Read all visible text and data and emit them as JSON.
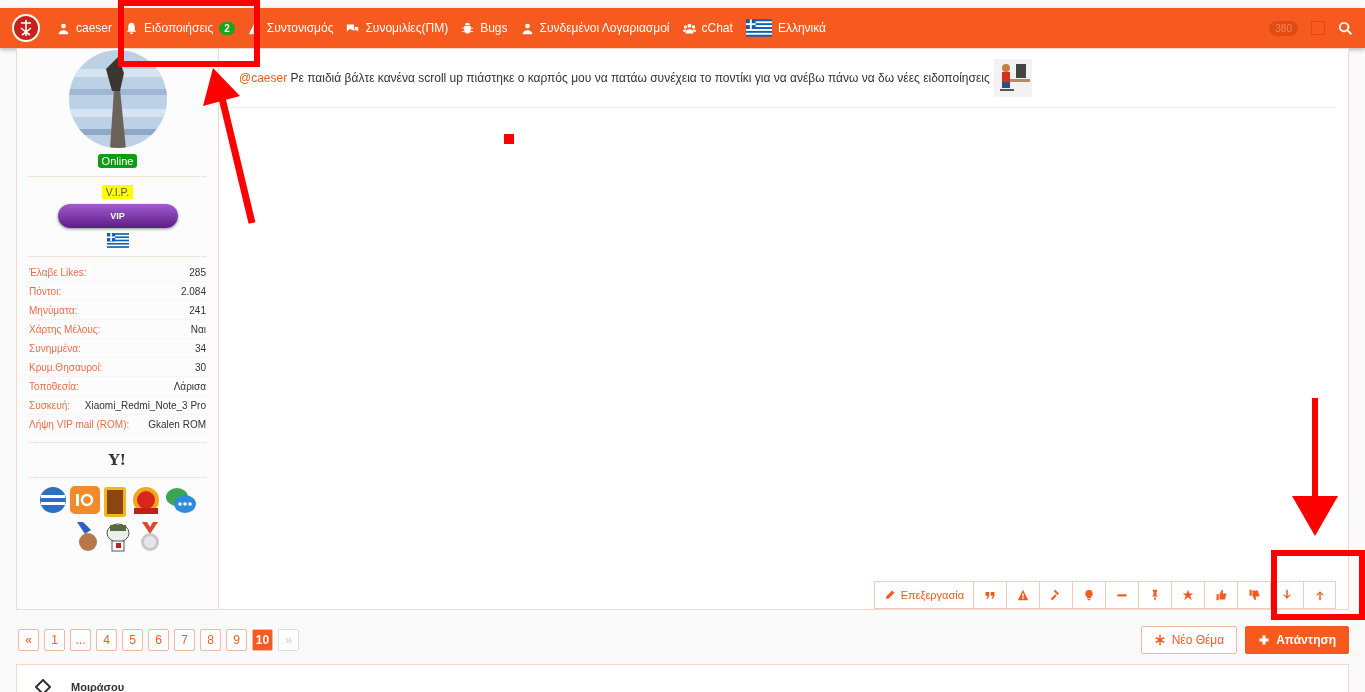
{
  "nav": {
    "items": [
      {
        "kind": "user",
        "label": "caeser"
      },
      {
        "kind": "bell",
        "label": "Ειδοποιήσεις",
        "badge": "2"
      },
      {
        "kind": "warning",
        "label": "Συντονισμός"
      },
      {
        "kind": "chat",
        "label": "Συνομιλίες(ΠΜ)"
      },
      {
        "kind": "bug",
        "label": "Bugs"
      },
      {
        "kind": "user",
        "label": "Συνδεμένοι Λογαριασμοί"
      },
      {
        "kind": "users",
        "label": "cChat"
      },
      {
        "kind": "flag",
        "label": "Ελληνικά"
      }
    ],
    "counter": "380"
  },
  "profile": {
    "status": "Online",
    "rank": "V.I.P.",
    "rank_bar": "VIP",
    "stats": [
      {
        "label": "Έλαβε Likes:",
        "value": "285"
      },
      {
        "label": "Πόντοι:",
        "value": "2.084"
      },
      {
        "label": "Μηνύματα:",
        "value": "241"
      },
      {
        "label": "Χάρτης Μέλους:",
        "value": "Ναι"
      },
      {
        "label": "Συνημμένα:",
        "value": "34"
      },
      {
        "label": "Κρυμ.Θησαυροί:",
        "value": "30"
      },
      {
        "label": "Τοποθεσία:",
        "value": "Λάρισα"
      },
      {
        "label": "Συσκευή:",
        "value": "Xiaomi_Redmi_Note_3 Pro"
      },
      {
        "label": "Λήψη VIP mail (ROM):",
        "value": "Gkalen ROM"
      }
    ],
    "messenger": "Y!"
  },
  "post": {
    "mention": "@caeser",
    "text": "Ρε παιδιά βάλτε κανένα scroll up πιάστηκε ο καρπός μου να πατάω συνέχεια το ποντίκι για να ανέβω πάνω να δω νέες ειδοποίησεις"
  },
  "actions": [
    {
      "kind": "pencil",
      "label": "Επεξεργασία"
    },
    {
      "kind": "quote"
    },
    {
      "kind": "warning"
    },
    {
      "kind": "gavel"
    },
    {
      "kind": "bulb"
    },
    {
      "kind": "minus"
    },
    {
      "kind": "pin"
    },
    {
      "kind": "star"
    },
    {
      "kind": "thumbup"
    },
    {
      "kind": "thumbdown"
    },
    {
      "kind": "down"
    },
    {
      "kind": "up"
    }
  ],
  "pagination": [
    {
      "label": "«",
      "selected": false,
      "disabled": false
    },
    {
      "label": "1",
      "selected": false,
      "disabled": false
    },
    {
      "label": "...",
      "selected": false,
      "disabled": false
    },
    {
      "label": "4",
      "selected": false,
      "disabled": false
    },
    {
      "label": "5",
      "selected": false,
      "disabled": false
    },
    {
      "label": "6",
      "selected": false,
      "disabled": false
    },
    {
      "label": "7",
      "selected": false,
      "disabled": false
    },
    {
      "label": "8",
      "selected": false,
      "disabled": false
    },
    {
      "label": "9",
      "selected": false,
      "disabled": false
    },
    {
      "label": "10",
      "selected": true,
      "disabled": false
    },
    {
      "label": "»",
      "selected": false,
      "disabled": true
    }
  ],
  "new_thread": "Νέο Θέμα",
  "reply": "Απάντηση",
  "share_title": "Μοιράσου"
}
